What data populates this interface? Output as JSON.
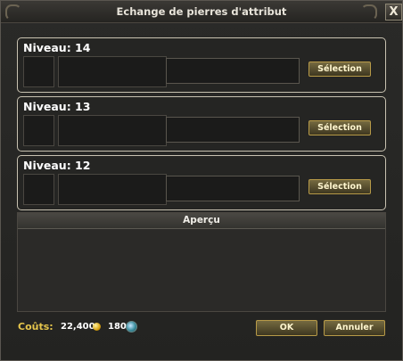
{
  "window": {
    "title": "Echange de pierres d'attribut",
    "close_symbol": "X"
  },
  "panels": [
    {
      "level": "Niveau: 14",
      "button": "Sélection"
    },
    {
      "level": "Niveau: 13",
      "button": "Sélection"
    },
    {
      "level": "Niveau: 12",
      "button": "Sélection"
    }
  ],
  "preview": {
    "title": "Aperçu"
  },
  "footer": {
    "cost_label": "Coûts:",
    "gold": "22,400",
    "points": "180",
    "ok": "OK",
    "cancel": "Annuler"
  },
  "icons": {
    "gold": "gold-coin-icon",
    "points": "gem-icon",
    "close": "close-icon"
  },
  "colors": {
    "accent": "#e6c64c",
    "button_border": "#b79a48"
  }
}
